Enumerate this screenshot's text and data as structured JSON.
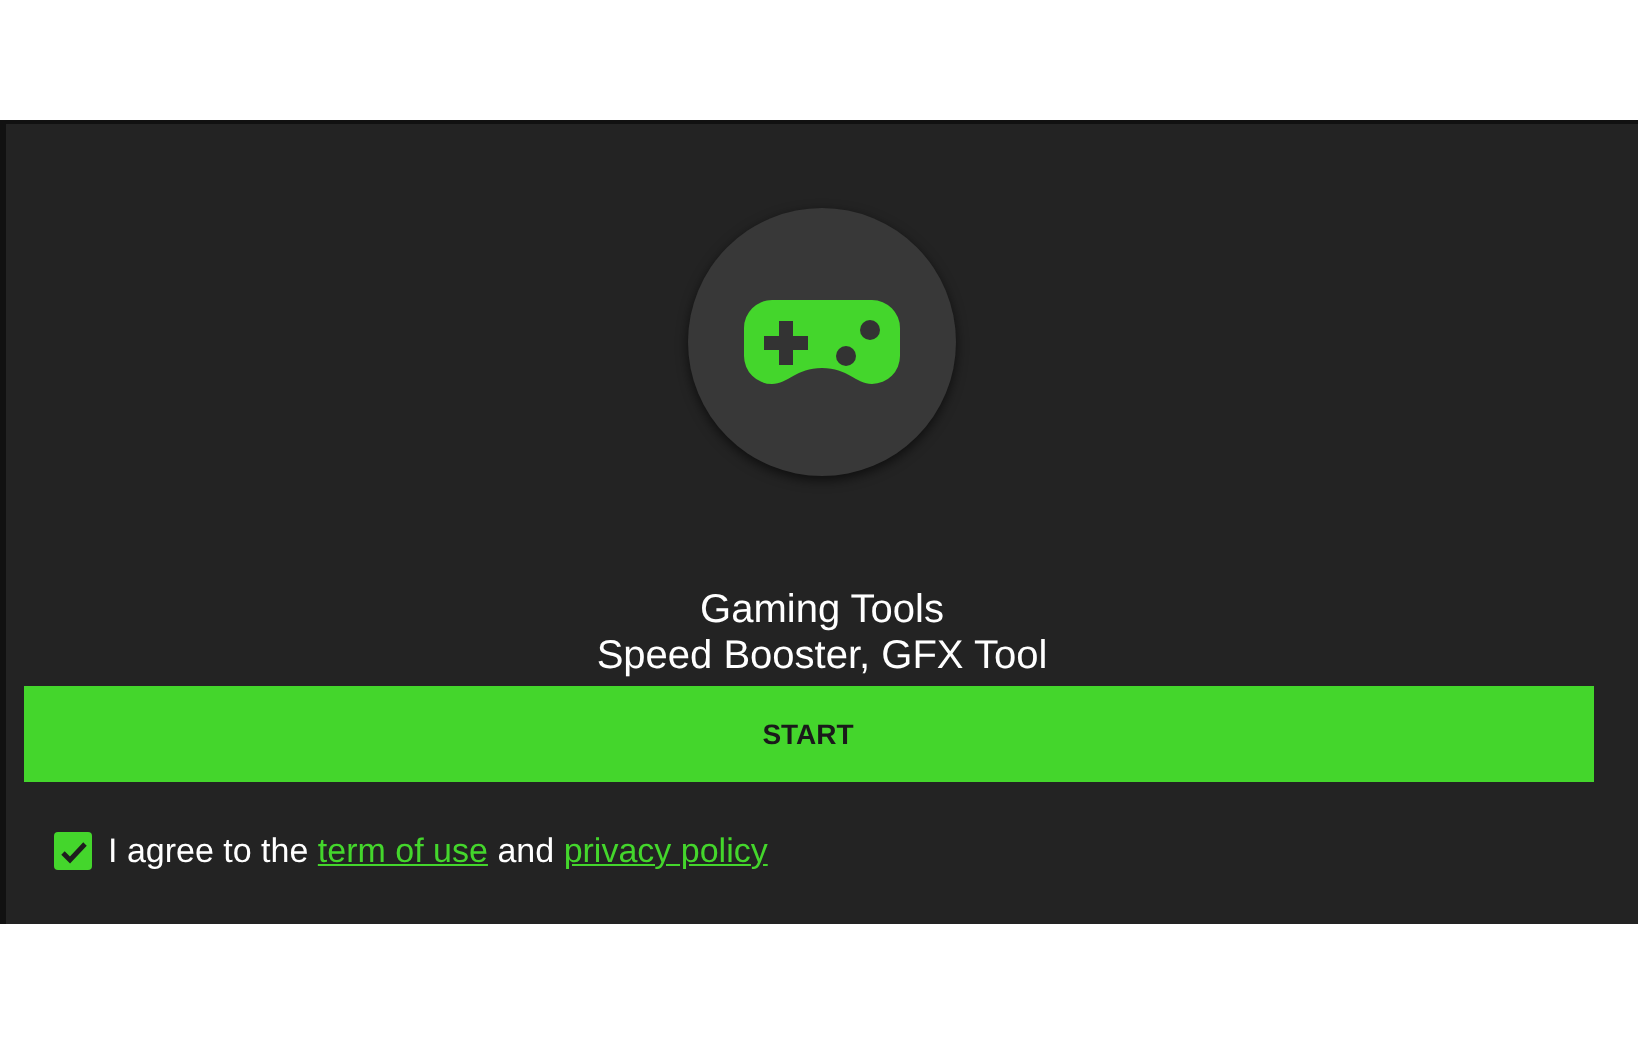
{
  "app": {
    "title": "Gaming Tools",
    "subtitle": "Speed Booster, GFX Tool"
  },
  "start_button": {
    "label": "START"
  },
  "agreement": {
    "checked": true,
    "before": "I agree to the",
    "link_terms": "term of use",
    "middle": "and",
    "link_privacy": "privacy policy"
  }
}
